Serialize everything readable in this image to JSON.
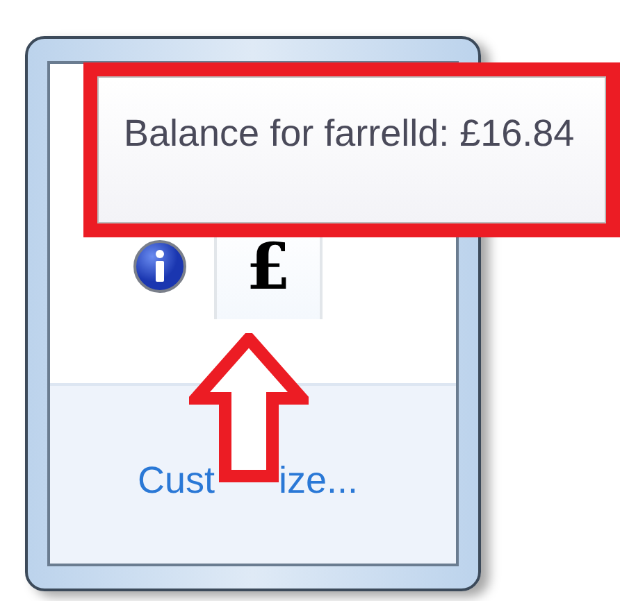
{
  "tooltip": {
    "text": "Balance for farrelld: £16.84",
    "highlighted": true
  },
  "tray_icons": [
    {
      "kind": "info",
      "selected": false
    },
    {
      "kind": "glyph",
      "glyph": "£",
      "selected": true
    }
  ],
  "customize_link": {
    "parts": [
      "Cust",
      "ize..."
    ]
  }
}
